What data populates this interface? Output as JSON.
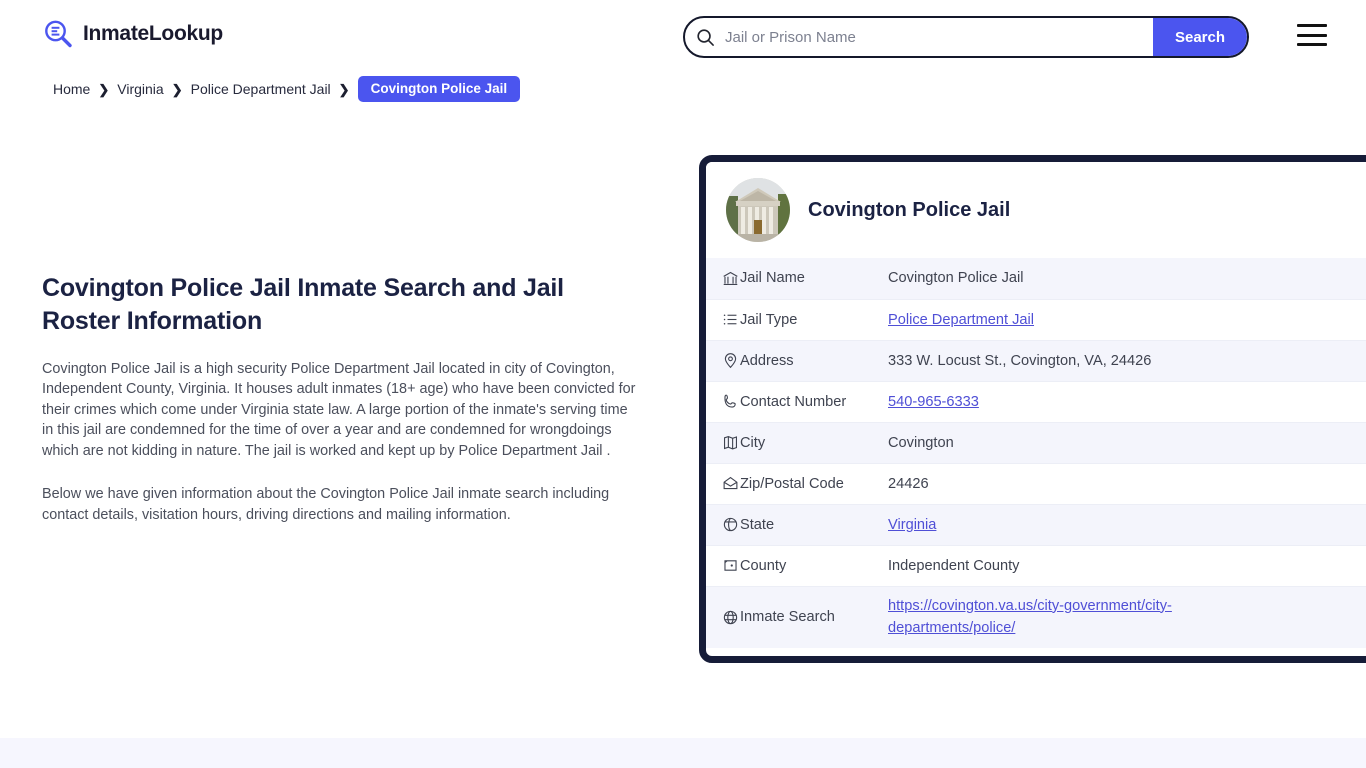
{
  "header": {
    "brand_name": "InmateLookup",
    "brand_icon": "search-list-logo-icon",
    "search": {
      "placeholder": "Jail or Prison Name",
      "value": "",
      "button_label": "Search",
      "icon": "search-icon"
    },
    "menu_icon": "hamburger-menu-icon"
  },
  "breadcrumb": {
    "items": [
      {
        "label": "Home",
        "current": false
      },
      {
        "label": "Virginia",
        "current": false
      },
      {
        "label": "Police Department Jail",
        "current": false
      },
      {
        "label": "Covington Police Jail",
        "current": true
      }
    ],
    "separator": "❯"
  },
  "main": {
    "title": "Covington Police Jail Inmate Search and Jail Roster Information",
    "paragraph_1": "Covington Police Jail is a high security Police Department Jail located in city of Covington, Independent County, Virginia. It houses adult inmates (18+ age) who have been convicted for their crimes which come under Virginia state law. A large portion of the inmate's serving time in this jail are condemned for the time of over a year and are condemned for wrongdoings which are not kidding in nature. The jail is worked and kept up by Police Department Jail .",
    "paragraph_2": "Below we have given information about the Covington Police Jail inmate search including contact details, visitation hours, driving directions and mailing information."
  },
  "info_card": {
    "title": "Covington Police Jail",
    "photo_alt": "courthouse-building-photo",
    "rows": [
      {
        "icon": "bank-building-icon",
        "label": "Jail Name",
        "value": "Covington Police Jail",
        "link": false
      },
      {
        "icon": "list-icon",
        "label": "Jail Type",
        "value": "Police Department Jail",
        "link": true
      },
      {
        "icon": "map-pin-icon",
        "label": "Address",
        "value": "333 W. Locust St., Covington, VA, 24426",
        "link": false
      },
      {
        "icon": "phone-icon",
        "label": "Contact Number",
        "value": "540-965-6333",
        "link": true
      },
      {
        "icon": "map-icon",
        "label": "City",
        "value": "Covington",
        "link": false
      },
      {
        "icon": "envelope-icon",
        "label": "Zip/Postal Code",
        "value": "24426",
        "link": false
      },
      {
        "icon": "globe-meridian-icon",
        "label": "State",
        "value": "Virginia",
        "link": true
      },
      {
        "icon": "county-badge-icon",
        "label": "County",
        "value": "Independent County",
        "link": false
      },
      {
        "icon": "globe-grid-icon",
        "label": "Inmate Search",
        "value": "https://covington.va.us/city-government/city-departments/police/",
        "link": true
      }
    ]
  },
  "colors": {
    "accent_blue": "#4b55ef",
    "card_border_navy": "#161c38",
    "row_tint": "#f4f5fc",
    "link_purple": "#4f4fd6",
    "title_navy": "#1b2243",
    "bottom_band": "#f6f6fe"
  }
}
